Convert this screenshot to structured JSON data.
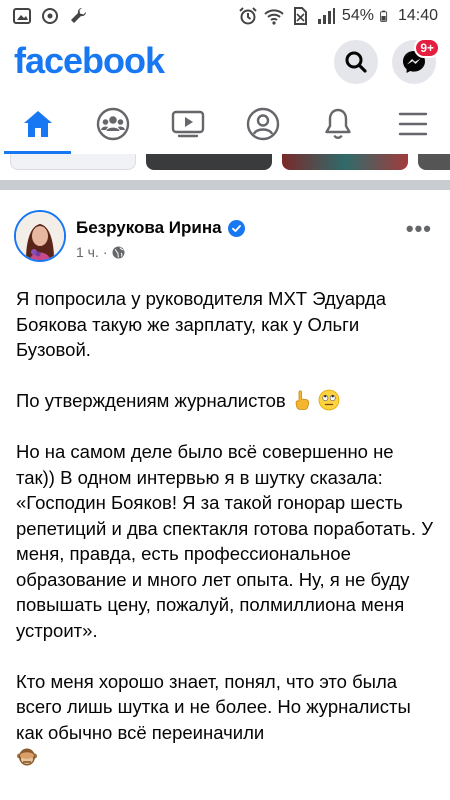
{
  "status_bar": {
    "battery_percent": "54%",
    "time": "14:40"
  },
  "header": {
    "logo": "facebook",
    "messenger_badge": "9+"
  },
  "tabs": [
    {
      "icon": "home-icon",
      "active": true
    },
    {
      "icon": "groups-icon",
      "active": false
    },
    {
      "icon": "watch-icon",
      "active": false
    },
    {
      "icon": "profile-icon",
      "active": false
    },
    {
      "icon": "bell-icon",
      "active": false
    },
    {
      "icon": "menu-icon",
      "active": false
    }
  ],
  "colors": {
    "brand": "#1877f2",
    "badge": "#e41e3f",
    "secondary_text": "#65676b"
  },
  "post": {
    "author": "Безрукова Ирина",
    "time": "1 ч.",
    "separator": "·",
    "paragraphs": [
      "Я попросила у руководителя МХТ Эдуарда Боякова такую же зарплату, как у Ольги Бузовой.",
      "По утверждениям журналистов",
      "Но на самом деле было всё совершенно не так)) В одном интервью я в шутку сказала: «Господин Бояков! Я за такой гонорар шесть репетиций и два спектакля готова поработать. У меня, правда, есть профессиональное образование и много лет опыта. Ну, я не буду повышать цену, пожалуй, полмиллиона меня устроит».",
      "Кто меня хорошо знает, понял, что это была всего лишь шутка и не более. Но журналисты как обычно всё переиначили"
    ]
  }
}
